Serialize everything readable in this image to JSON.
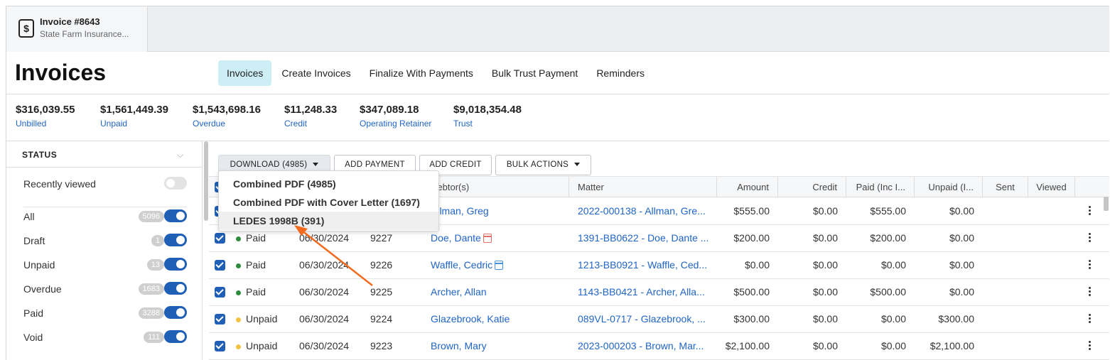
{
  "tab": {
    "title": "Invoice #8643",
    "subtitle": "State Farm Insurance..."
  },
  "header": {
    "title": "Invoices",
    "nav": [
      "Invoices",
      "Create Invoices",
      "Finalize With Payments",
      "Bulk Trust Payment",
      "Reminders"
    ]
  },
  "summary": [
    {
      "value": "$316,039.55",
      "label": "Unbilled"
    },
    {
      "value": "$1,561,449.39",
      "label": "Unpaid"
    },
    {
      "value": "$1,543,698.16",
      "label": "Overdue"
    },
    {
      "value": "$11,248.33",
      "label": "Credit"
    },
    {
      "value": "$347,089.18",
      "label": "Operating Retainer"
    },
    {
      "value": "$9,018,354.48",
      "label": "Trust"
    }
  ],
  "sidebar": {
    "heading": "STATUS",
    "recently_viewed": "Recently viewed",
    "items": [
      {
        "label": "All",
        "count": "5096"
      },
      {
        "label": "Draft",
        "count": "1"
      },
      {
        "label": "Unpaid",
        "count": "13"
      },
      {
        "label": "Overdue",
        "count": "1683"
      },
      {
        "label": "Paid",
        "count": "3288"
      },
      {
        "label": "Void",
        "count": "111"
      }
    ]
  },
  "toolbar": {
    "download": "DOWNLOAD (4985)",
    "add_payment": "ADD PAYMENT",
    "add_credit": "ADD CREDIT",
    "bulk_actions": "BULK ACTIONS"
  },
  "download_menu": [
    "Combined PDF (4985)",
    "Combined PDF with Cover Letter (1697)",
    "LEDES 1998B (391)"
  ],
  "table": {
    "columns": {
      "debtor": "Debtor(s)",
      "matter": "Matter",
      "amount": "Amount",
      "credit": "Credit",
      "paid": "Paid (Inc I...",
      "unpaid": "Unpaid (I...",
      "sent": "Sent",
      "viewed": "Viewed"
    },
    "rows": [
      {
        "status": "",
        "date": "",
        "num": "",
        "debtor": "Allman, Greg",
        "matter": "2022-000138 - Allman, Gre...",
        "amount": "$555.00",
        "credit": "$0.00",
        "paid": "$555.00",
        "unpaid": "$0.00"
      },
      {
        "status": "Paid",
        "date": "06/30/2024",
        "num": "9227",
        "debtor": "Doe, Dante",
        "matter": "1391-BB0622 - Doe, Dante ...",
        "amount": "$200.00",
        "credit": "$0.00",
        "paid": "$200.00",
        "unpaid": "$0.00"
      },
      {
        "status": "Paid",
        "date": "06/30/2024",
        "num": "9226",
        "debtor": "Waffle, Cedric",
        "matter": "1213-BB0921 - Waffle, Ced...",
        "amount": "$0.00",
        "credit": "$0.00",
        "paid": "$0.00",
        "unpaid": "$0.00"
      },
      {
        "status": "Paid",
        "date": "06/30/2024",
        "num": "9225",
        "debtor": "Archer, Allan",
        "matter": "1143-BB0421 - Archer, Alla...",
        "amount": "$500.00",
        "credit": "$0.00",
        "paid": "$500.00",
        "unpaid": "$0.00"
      },
      {
        "status": "Unpaid",
        "date": "06/30/2024",
        "num": "9224",
        "debtor": "Glazebrook, Katie",
        "matter": "089VL-0717 - Glazebrook, ...",
        "amount": "$300.00",
        "credit": "$0.00",
        "paid": "$0.00",
        "unpaid": "$300.00"
      },
      {
        "status": "Unpaid",
        "date": "06/30/2024",
        "num": "9223",
        "debtor": "Brown, Mary",
        "matter": "2023-000203 - Brown, Mar...",
        "amount": "$2,100.00",
        "credit": "$0.00",
        "paid": "$0.00",
        "unpaid": "$2,100.00"
      }
    ]
  },
  "colors": {
    "accent": "#1f5fb5",
    "link": "#1f64c7",
    "active_tab": "#cdeef5",
    "paid_dot": "#2e8b3e",
    "unpaid_dot": "#f5c242",
    "arrow": "#f26a1b",
    "calendar_red": "#e0706a",
    "calendar_blue": "#4a90d9"
  }
}
